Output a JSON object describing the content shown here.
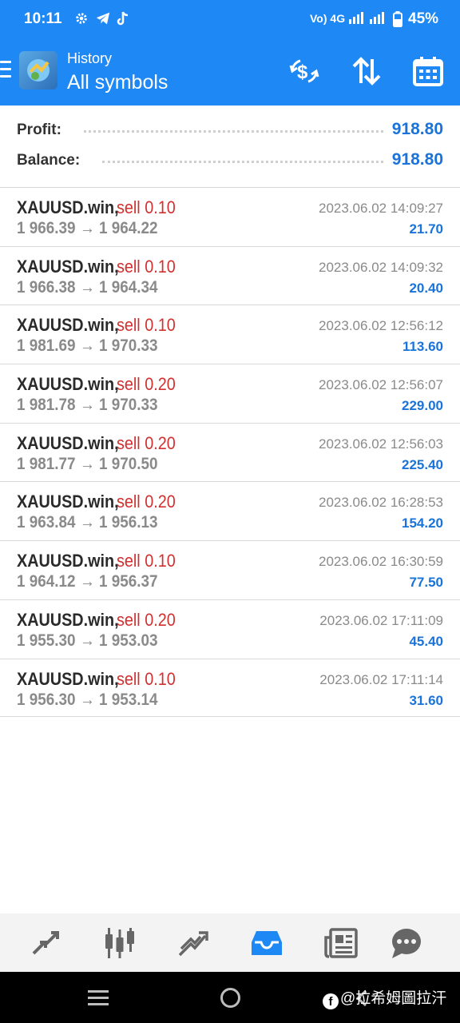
{
  "status_bar": {
    "time": "10:11",
    "network": "Vo) 4G",
    "battery": "45%",
    "icons": [
      "gear-icon",
      "telegram-icon",
      "tiktok-icon",
      "signal-icon",
      "battery-icon"
    ]
  },
  "toolbar": {
    "subtitle": "History",
    "title": "All symbols",
    "buttons": [
      "currency-exchange-icon",
      "sort-icon",
      "calendar-icon"
    ]
  },
  "summary": {
    "profit_label": "Profit:",
    "profit_value": "918.80",
    "balance_label": "Balance:",
    "balance_value": "918.80"
  },
  "trades": [
    {
      "symbol": "XAUUSD.win,",
      "side": "sell 0.10",
      "prices": "1 966.39 → 1 964.22",
      "time": "2023.06.02 14:09:27",
      "profit": "21.70"
    },
    {
      "symbol": "XAUUSD.win,",
      "side": "sell 0.10",
      "prices": "1 966.38 → 1 964.34",
      "time": "2023.06.02 14:09:32",
      "profit": "20.40"
    },
    {
      "symbol": "XAUUSD.win,",
      "side": "sell 0.10",
      "prices": "1 981.69 → 1 970.33",
      "time": "2023.06.02 12:56:12",
      "profit": "113.60"
    },
    {
      "symbol": "XAUUSD.win,",
      "side": "sell 0.20",
      "prices": "1 981.78 → 1 970.33",
      "time": "2023.06.02 12:56:07",
      "profit": "229.00"
    },
    {
      "symbol": "XAUUSD.win,",
      "side": "sell 0.20",
      "prices": "1 981.77 → 1 970.50",
      "time": "2023.06.02 12:56:03",
      "profit": "225.40"
    },
    {
      "symbol": "XAUUSD.win,",
      "side": "sell 0.20",
      "prices": "1 963.84 → 1 956.13",
      "time": "2023.06.02 16:28:53",
      "profit": "154.20"
    },
    {
      "symbol": "XAUUSD.win,",
      "side": "sell 0.10",
      "prices": "1 964.12 → 1 956.37",
      "time": "2023.06.02 16:30:59",
      "profit": "77.50"
    },
    {
      "symbol": "XAUUSD.win,",
      "side": "sell 0.20",
      "prices": "1 955.30 → 1 953.03",
      "time": "2023.06.02 17:11:09",
      "profit": "45.40"
    },
    {
      "symbol": "XAUUSD.win,",
      "side": "sell 0.10",
      "prices": "1 956.30 → 1 953.14",
      "time": "2023.06.02 17:11:14",
      "profit": "31.60"
    }
  ],
  "bottom_nav": {
    "items": [
      "quotes-icon",
      "chart-icon",
      "trade-icon",
      "history-icon",
      "news-icon",
      "chat-icon"
    ],
    "active": "history-icon"
  },
  "watermark": {
    "text": "@拉希姆圖拉汗"
  },
  "colors": {
    "header": "#1e88f5",
    "sell": "#d32f2f",
    "profit": "#1a73d9",
    "price": "#8a8a8a"
  }
}
